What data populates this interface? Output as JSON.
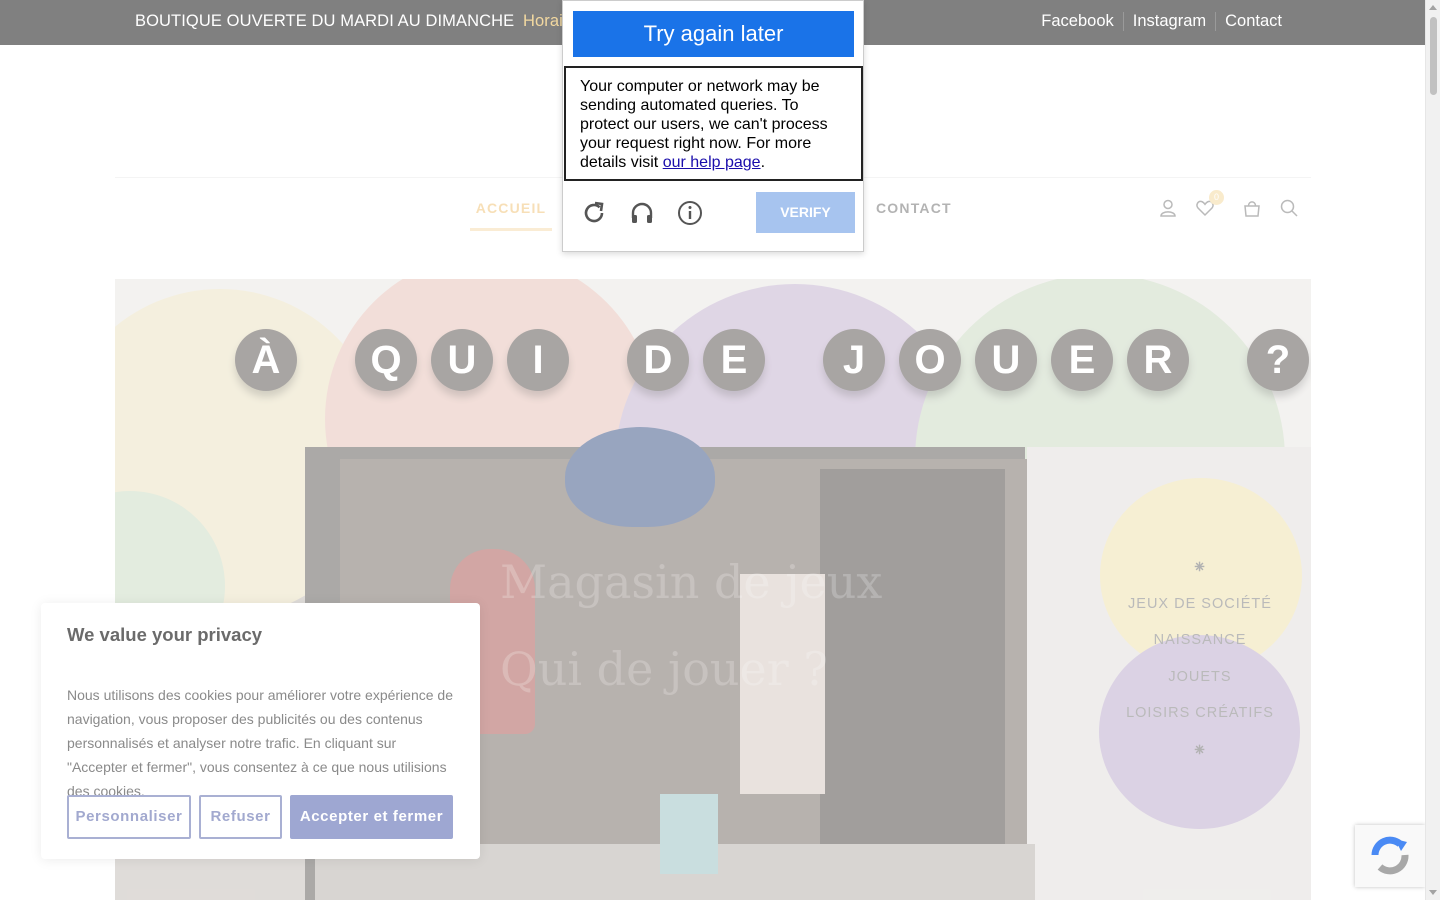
{
  "topbar": {
    "announcement": "BOUTIQUE OUVERTE DU MARDI AU DIMANCHE",
    "hours_link": "Horaires",
    "links": [
      "Facebook",
      "Instagram",
      "Contact"
    ]
  },
  "nav": {
    "items": [
      "ACCUEIL",
      "CONTACT"
    ],
    "wishlist_count": "0"
  },
  "hero": {
    "sign_letters": [
      "À",
      "Q",
      "U",
      "I",
      "D",
      "E",
      "J",
      "O",
      "U",
      "E",
      "R",
      "?"
    ],
    "ghost_text_1": "Magasin de jeux",
    "ghost_text_2": "Qui de jouer ?",
    "categories": [
      "JEUX DE SOCIÉTÉ",
      "NAISSANCE",
      "JOUETS",
      "LOISIRS CRÉATIFS"
    ],
    "sparkle": "⁕"
  },
  "captcha": {
    "title": "Try again later",
    "message": "Your computer or network may be sending automated queries. To protect our users, we can't process your request right now. For more details visit",
    "help_link": "our help page",
    "period": ".",
    "verify_label": "VERIFY"
  },
  "cookie": {
    "title": "We value your privacy",
    "body": "Nous utilisons des cookies pour améliorer votre expérience de navigation, vous proposer des publicités ou des contenus personnalisés et analyser notre trafic. En cliquant sur \"Accepter et fermer\", vous consentez à ce que nous utilisions des cookies.",
    "customize": "Personnaliser",
    "refuse": "Refuser",
    "accept": "Accepter et fermer"
  },
  "colors": {
    "topbar_bg": "#808080",
    "accent_gold": "#f2c984",
    "captcha_blue": "#1a73e8",
    "cookie_button": "#9ea7d2"
  }
}
